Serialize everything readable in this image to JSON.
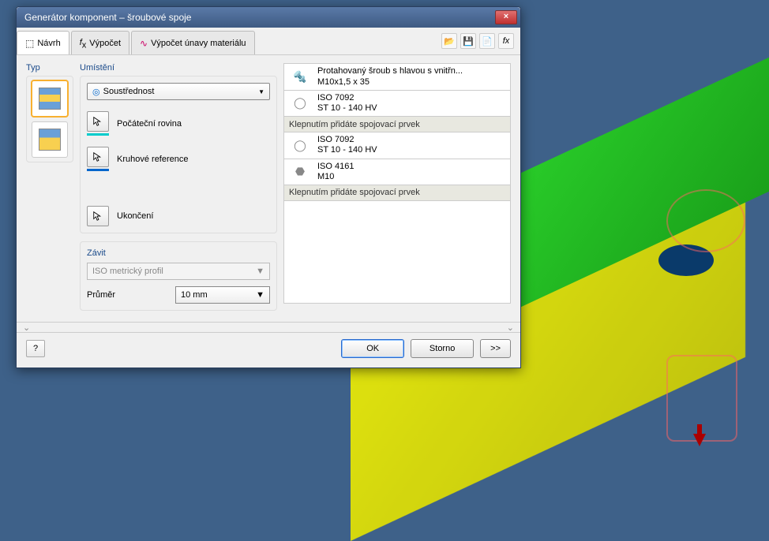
{
  "window": {
    "title": "Generátor komponent – šroubové spoje",
    "close": "×"
  },
  "tabs": {
    "design": "Návrh",
    "calc": "Výpočet",
    "fatigue": "Výpočet únavy materiálu"
  },
  "toolbar": {
    "open": "📂",
    "save": "💾",
    "options": "⚙",
    "fx": "fx"
  },
  "type": {
    "label": "Typ"
  },
  "placement": {
    "label": "Umístění",
    "mode": "Soustřednost",
    "start_plane": "Počáteční rovina",
    "circ_ref": "Kruhové reference",
    "end": "Ukončení"
  },
  "thread": {
    "label": "Závit",
    "profile": "ISO metrický profil",
    "diameter_label": "Průměr",
    "diameter_value": "10 mm"
  },
  "parts": {
    "items": [
      {
        "icon": "bolt",
        "line1": "Protahovaný šroub s hlavou s vnitřn...",
        "line2": "M10x1,5 x 35"
      },
      {
        "icon": "washer",
        "line1": "ISO 7092",
        "line2": "ST 10 - 140 HV"
      }
    ],
    "hint1": "Klepnutím přidáte spojovací prvek",
    "items2": [
      {
        "icon": "washer",
        "line1": "ISO 7092",
        "line2": "ST 10 - 140 HV"
      },
      {
        "icon": "nut",
        "line1": "ISO 4161",
        "line2": "M10"
      }
    ],
    "hint2": "Klepnutím přidáte spojovací prvek"
  },
  "footer": {
    "ok": "OK",
    "cancel": "Storno",
    "more": ">>"
  },
  "expand": {
    "left": "⌄",
    "right": "⌄"
  }
}
